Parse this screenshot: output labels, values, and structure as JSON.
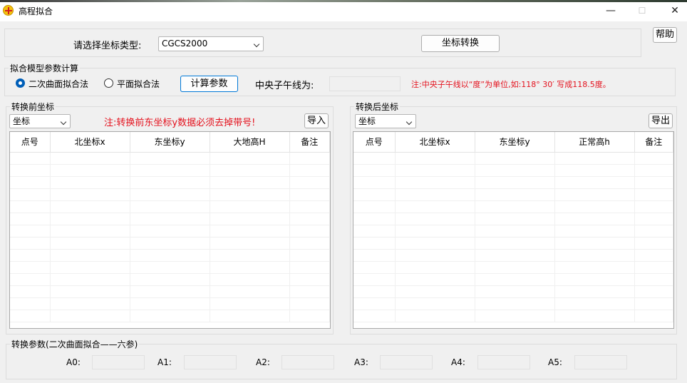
{
  "window": {
    "title": "高程拟合",
    "minimize": "—",
    "maximize": "☐",
    "close": "✕"
  },
  "help_label": "帮助",
  "coord_select": {
    "label": "请选择坐标类型:",
    "value": "CGCS2000",
    "convert_button": "坐标转换"
  },
  "model": {
    "group_title": "拟合模型参数计算",
    "radio_quadratic": "二次曲面拟合法",
    "radio_plane": "平面拟合法",
    "selected": "二次曲面拟合法",
    "calc_button": "计算参数",
    "meridian_label": "中央子午线为:",
    "meridian_value": "",
    "note": "注:中央子午线以“度”为单位,如:118° 30′ 写成118.5度。"
  },
  "before": {
    "group_title": "转换前坐标",
    "combo_value": "坐标",
    "note": "注:转换前东坐标y数据必须去掉带号!",
    "import_button": "导入",
    "columns": [
      "点号",
      "北坐标x",
      "东坐标y",
      "大地高H",
      "备注"
    ]
  },
  "after": {
    "group_title": "转换后坐标",
    "combo_value": "坐标",
    "export_button": "导出",
    "columns": [
      "点号",
      "北坐标x",
      "东坐标y",
      "正常高h",
      "备注"
    ]
  },
  "params": {
    "group_title": "转换参数(二次曲面拟合——六参)",
    "labels": [
      "A0:",
      "A1:",
      "A2:",
      "A3:",
      "A4:",
      "A5:"
    ],
    "values": [
      "",
      "",
      "",
      "",
      "",
      ""
    ]
  }
}
